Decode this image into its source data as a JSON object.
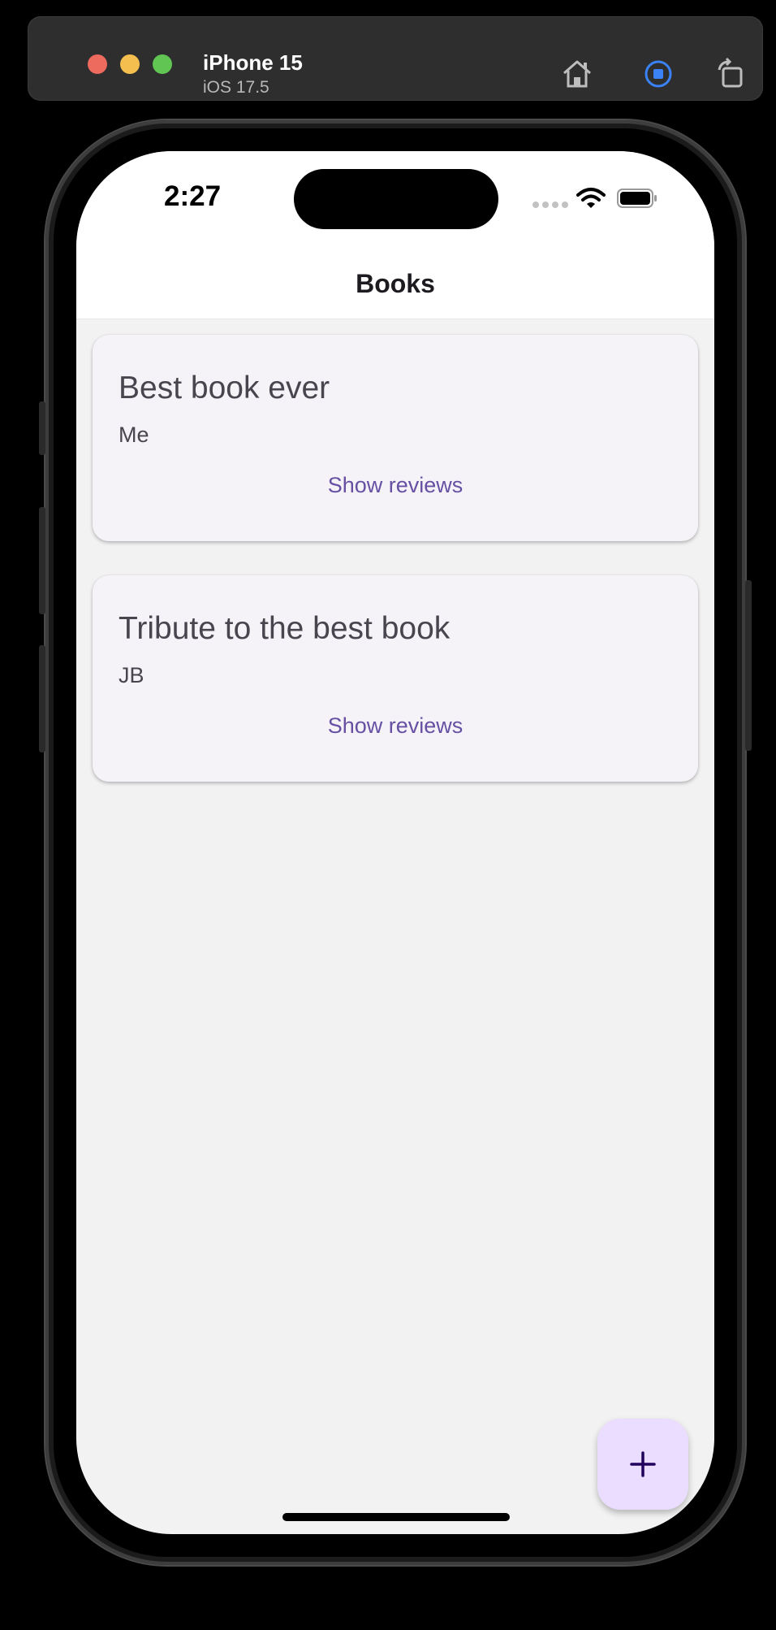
{
  "simulator": {
    "device_name": "iPhone 15",
    "os_version": "iOS 17.5",
    "toolbar_icons": [
      "home-icon",
      "screenshot-record-icon",
      "rotate-icon"
    ]
  },
  "status_bar": {
    "time": "2:27",
    "icons": [
      "signal-dots-icon",
      "wifi-icon",
      "battery-icon"
    ]
  },
  "app_bar": {
    "title": "Books"
  },
  "books": [
    {
      "title": "Best book ever",
      "author": "Me",
      "action_label": "Show reviews"
    },
    {
      "title": "Tribute to the best book",
      "author": "JB",
      "action_label": "Show reviews"
    }
  ],
  "fab": {
    "icon": "plus-icon"
  },
  "colors": {
    "accent": "#6750a4",
    "card_bg": "#f5f3f8",
    "fab_bg": "#eaddff",
    "screen_bg": "#f2f2f2"
  }
}
